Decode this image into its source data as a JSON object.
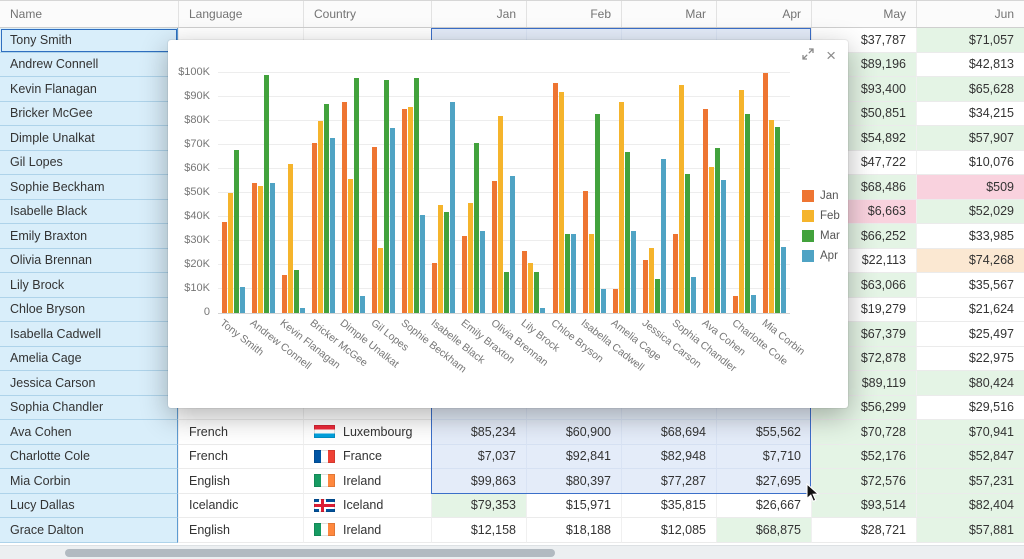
{
  "grid": {
    "columns": [
      {
        "label": "Name",
        "align": "left",
        "width": "col-name"
      },
      {
        "label": "Language",
        "align": "left",
        "width": "col-lang"
      },
      {
        "label": "Country",
        "align": "left",
        "width": "col-country"
      },
      {
        "label": "Jan",
        "align": "right",
        "width": "col-m"
      },
      {
        "label": "Feb",
        "align": "right",
        "width": "col-m"
      },
      {
        "label": "Mar",
        "align": "right",
        "width": "col-m"
      },
      {
        "label": "Apr",
        "align": "right",
        "width": "col-m"
      },
      {
        "label": "May",
        "align": "right",
        "width": "col-may"
      },
      {
        "label": "Jun",
        "align": "right",
        "width": "col-jun"
      }
    ],
    "rows": [
      {
        "name": "Tony Smith",
        "language": "",
        "country": "",
        "flag": "",
        "months": [
          [
            "",
            "sel"
          ],
          [
            "",
            "sel"
          ],
          [
            "",
            "sel"
          ],
          [
            "",
            "sel"
          ],
          [
            "$37,787",
            ""
          ],
          [
            "$71,057",
            "green"
          ]
        ]
      },
      {
        "name": "Andrew Connell",
        "language": "",
        "country": "",
        "flag": "",
        "months": [
          [
            "",
            "sel"
          ],
          [
            "",
            "sel"
          ],
          [
            "",
            "sel"
          ],
          [
            "",
            "sel"
          ],
          [
            "$89,196",
            "green"
          ],
          [
            "$42,813",
            ""
          ]
        ]
      },
      {
        "name": "Kevin Flanagan",
        "language": "",
        "country": "",
        "flag": "",
        "months": [
          [
            "",
            "sel"
          ],
          [
            "",
            "sel"
          ],
          [
            "",
            "sel"
          ],
          [
            "",
            "sel"
          ],
          [
            "$93,400",
            "green"
          ],
          [
            "$65,628",
            "green"
          ]
        ]
      },
      {
        "name": "Bricker McGee",
        "language": "",
        "country": "",
        "flag": "",
        "months": [
          [
            "",
            "sel"
          ],
          [
            "",
            "sel"
          ],
          [
            "",
            "sel"
          ],
          [
            "",
            "sel"
          ],
          [
            "$50,851",
            "green"
          ],
          [
            "$34,215",
            ""
          ]
        ]
      },
      {
        "name": "Dimple Unalkat",
        "language": "",
        "country": "",
        "flag": "",
        "months": [
          [
            "",
            "sel"
          ],
          [
            "",
            "sel"
          ],
          [
            "",
            "sel"
          ],
          [
            "",
            "sel"
          ],
          [
            "$54,892",
            "green"
          ],
          [
            "$57,907",
            "green"
          ]
        ]
      },
      {
        "name": "Gil Lopes",
        "language": "",
        "country": "",
        "flag": "",
        "months": [
          [
            "",
            "sel"
          ],
          [
            "",
            "sel"
          ],
          [
            "",
            "sel"
          ],
          [
            "",
            "sel"
          ],
          [
            "$47,722",
            ""
          ],
          [
            "$10,076",
            ""
          ]
        ]
      },
      {
        "name": "Sophie Beckham",
        "language": "",
        "country": "",
        "flag": "",
        "months": [
          [
            "",
            "sel"
          ],
          [
            "",
            "sel"
          ],
          [
            "",
            "sel"
          ],
          [
            "",
            "sel"
          ],
          [
            "$68,486",
            "green"
          ],
          [
            "$509",
            "pink"
          ]
        ]
      },
      {
        "name": "Isabelle Black",
        "language": "",
        "country": "",
        "flag": "",
        "months": [
          [
            "",
            "sel"
          ],
          [
            "",
            "sel"
          ],
          [
            "",
            "sel"
          ],
          [
            "",
            "sel"
          ],
          [
            "$6,663",
            "pink"
          ],
          [
            "$52,029",
            "green"
          ]
        ]
      },
      {
        "name": "Emily Braxton",
        "language": "",
        "country": "",
        "flag": "",
        "months": [
          [
            "",
            "sel"
          ],
          [
            "",
            "sel"
          ],
          [
            "",
            "sel"
          ],
          [
            "",
            "sel"
          ],
          [
            "$66,252",
            "green"
          ],
          [
            "$33,985",
            ""
          ]
        ]
      },
      {
        "name": "Olivia Brennan",
        "language": "",
        "country": "",
        "flag": "",
        "months": [
          [
            "",
            "sel"
          ],
          [
            "",
            "sel"
          ],
          [
            "",
            "sel"
          ],
          [
            "",
            "sel"
          ],
          [
            "$22,113",
            ""
          ],
          [
            "$74,268",
            "peach"
          ]
        ]
      },
      {
        "name": "Lily Brock",
        "language": "",
        "country": "",
        "flag": "",
        "months": [
          [
            "",
            "sel"
          ],
          [
            "",
            "sel"
          ],
          [
            "",
            "sel"
          ],
          [
            "",
            "sel"
          ],
          [
            "$63,066",
            "green"
          ],
          [
            "$35,567",
            ""
          ]
        ]
      },
      {
        "name": "Chloe Bryson",
        "language": "",
        "country": "",
        "flag": "",
        "months": [
          [
            "",
            "sel"
          ],
          [
            "",
            "sel"
          ],
          [
            "",
            "sel"
          ],
          [
            "",
            "sel"
          ],
          [
            "$19,279",
            ""
          ],
          [
            "$21,624",
            ""
          ]
        ]
      },
      {
        "name": "Isabella Cadwell",
        "language": "",
        "country": "",
        "flag": "",
        "months": [
          [
            "",
            "sel"
          ],
          [
            "",
            "sel"
          ],
          [
            "",
            "sel"
          ],
          [
            "",
            "sel"
          ],
          [
            "$67,379",
            "green"
          ],
          [
            "$25,497",
            ""
          ]
        ]
      },
      {
        "name": "Amelia Cage",
        "language": "",
        "country": "",
        "flag": "",
        "months": [
          [
            "",
            "sel"
          ],
          [
            "",
            "sel"
          ],
          [
            "",
            "sel"
          ],
          [
            "",
            "sel"
          ],
          [
            "$72,878",
            "green"
          ],
          [
            "$22,975",
            ""
          ]
        ]
      },
      {
        "name": "Jessica Carson",
        "language": "",
        "country": "",
        "flag": "",
        "months": [
          [
            "",
            "sel"
          ],
          [
            "",
            "sel"
          ],
          [
            "",
            "sel"
          ],
          [
            "",
            "sel"
          ],
          [
            "$89,119",
            "green"
          ],
          [
            "$80,424",
            "green"
          ]
        ]
      },
      {
        "name": "Sophia Chandler",
        "language": "",
        "country": "",
        "flag": "",
        "months": [
          [
            "",
            "sel"
          ],
          [
            "",
            "sel"
          ],
          [
            "",
            "sel"
          ],
          [
            "",
            "sel"
          ],
          [
            "$56,299",
            "green"
          ],
          [
            "$29,516",
            ""
          ]
        ]
      },
      {
        "name": "Ava Cohen",
        "language": "French",
        "country": "Luxembourg",
        "flag": "lu",
        "months": [
          [
            "$85,234",
            "sel"
          ],
          [
            "$60,900",
            "sel"
          ],
          [
            "$68,694",
            "sel"
          ],
          [
            "$55,562",
            "sel"
          ],
          [
            "$70,728",
            "green"
          ],
          [
            "$70,941",
            "green"
          ]
        ]
      },
      {
        "name": "Charlotte Cole",
        "language": "French",
        "country": "France",
        "flag": "fr",
        "months": [
          [
            "$7,037",
            "sel"
          ],
          [
            "$92,841",
            "sel"
          ],
          [
            "$82,948",
            "sel"
          ],
          [
            "$7,710",
            "sel"
          ],
          [
            "$52,176",
            "green"
          ],
          [
            "$52,847",
            "green"
          ]
        ]
      },
      {
        "name": "Mia Corbin",
        "language": "English",
        "country": "Ireland",
        "flag": "ie",
        "months": [
          [
            "$99,863",
            "sel"
          ],
          [
            "$80,397",
            "sel"
          ],
          [
            "$77,287",
            "sel"
          ],
          [
            "$27,695",
            "sel"
          ],
          [
            "$72,576",
            "green"
          ],
          [
            "$57,231",
            "green"
          ]
        ]
      },
      {
        "name": "Lucy Dallas",
        "language": "Icelandic",
        "country": "Iceland",
        "flag": "is",
        "months": [
          [
            "$79,353",
            "green"
          ],
          [
            "$15,971",
            ""
          ],
          [
            "$35,815",
            ""
          ],
          [
            "$26,667",
            ""
          ],
          [
            "$93,514",
            "green"
          ],
          [
            "$82,404",
            "green"
          ]
        ]
      },
      {
        "name": "Grace Dalton",
        "language": "English",
        "country": "Ireland",
        "flag": "ie",
        "months": [
          [
            "$12,158",
            ""
          ],
          [
            "$18,188",
            ""
          ],
          [
            "$12,085",
            ""
          ],
          [
            "$68,875",
            "green"
          ],
          [
            "$28,721",
            ""
          ],
          [
            "$57,881",
            "green"
          ]
        ]
      }
    ]
  },
  "popup": {
    "close_icon": "×"
  },
  "chart_data": {
    "type": "bar",
    "title": "",
    "categories": [
      "Tony Smith",
      "Andrew Connell",
      "Kevin Flanagan",
      "Bricker McGee",
      "Dimple Unalkat",
      "Gil Lopes",
      "Sophie Beckham",
      "Isabelle Black",
      "Emily Braxton",
      "Olivia Brennan",
      "Lily Brock",
      "Chloe Bryson",
      "Isabella Cadwell",
      "Amelia Cage",
      "Jessica Carson",
      "Sophia Chandler",
      "Ava Cohen",
      "Charlotte Cole",
      "Mia Corbin"
    ],
    "series": [
      {
        "name": "Jan",
        "color": "#ee7532",
        "values": [
          38,
          54,
          16,
          71,
          88,
          69,
          85,
          21,
          32,
          55,
          26,
          96,
          51,
          10,
          22,
          33,
          85.2,
          7,
          99.9
        ]
      },
      {
        "name": "Feb",
        "color": "#f5b42c",
        "values": [
          50,
          53,
          62,
          80,
          56,
          27,
          86,
          45,
          46,
          82,
          21,
          92,
          33,
          88,
          27,
          95,
          60.9,
          92.8,
          80.4
        ]
      },
      {
        "name": "Mar",
        "color": "#42a23c",
        "values": [
          68,
          99,
          18,
          87,
          98,
          97,
          98,
          42,
          71,
          17,
          17,
          33,
          83,
          67,
          14,
          58,
          68.7,
          82.9,
          77.3
        ]
      },
      {
        "name": "Apr",
        "color": "#4fa3c4",
        "values": [
          11,
          54,
          2,
          73,
          7,
          77,
          41,
          88,
          34,
          57,
          2,
          33,
          10,
          34,
          64,
          15,
          55.6,
          7.7,
          27.7
        ]
      }
    ],
    "ylim": [
      0,
      100
    ],
    "y_ticks": [
      "0",
      "$10K",
      "$20K",
      "$30K",
      "$40K",
      "$50K",
      "$60K",
      "$70K",
      "$80K",
      "$90K",
      "$100K"
    ],
    "ylabel": "",
    "xlabel": "",
    "legend_position": "right",
    "grid": "horizontal",
    "unit_thousands": true
  },
  "colors": {
    "selection_border": "#3b6fc9",
    "selected_range_bg": "#e4ecf9",
    "name_column_bg": "#d9eefa",
    "cell_green": "#e4f4e5",
    "cell_pink": "#f9d2de",
    "cell_peach": "#fbe8d2"
  }
}
